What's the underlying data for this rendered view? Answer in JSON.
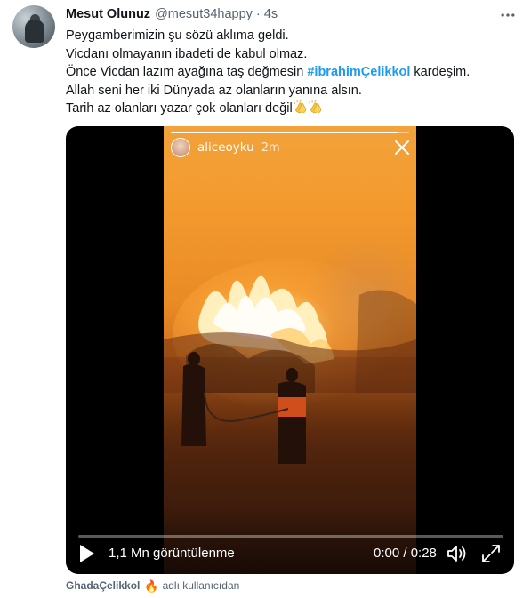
{
  "tweet": {
    "author_name": "Mesut Olunuz",
    "author_handle": "@mesut34happy",
    "separator": "·",
    "timestamp": "4s",
    "more_icon": "more-horizontal-icon",
    "text": {
      "line1": "Peygamberimizin şu sözü aklıma geldi.",
      "line2": "Vicdanı olmayanın ibadeti de kabul olmaz.",
      "line3_before": "Önce Vicdan lazım ayağına taş değmesin ",
      "line3_hashtag": "#ibrahimÇelikkol",
      "line3_after": " kardeşim.",
      "line4": "Allah seni her iki Dünyada az olanların yanına alsın.",
      "line5": "Tarih az olanları yazar çok olanları değil",
      "emoji": "clapping-hands-icon"
    }
  },
  "video": {
    "story_username": "aliceoyku",
    "story_age": "2m",
    "story_progress": 0.95,
    "view_count": "1,1 Mn görüntülenme",
    "timecode": "0:00 / 0:28",
    "playback_progress": 0.0,
    "play_icon": "play-icon",
    "volume_icon": "volume-icon",
    "fullscreen_icon": "fullscreen-icon",
    "close_icon": "close-icon"
  },
  "footer": {
    "username": "GhadaÇelikkol",
    "emoji": "🔥",
    "label": "adlı kullanıcıdan"
  },
  "colors": {
    "link_blue": "#1d9bf0",
    "text_primary": "#0f1419",
    "text_secondary": "#536471"
  }
}
